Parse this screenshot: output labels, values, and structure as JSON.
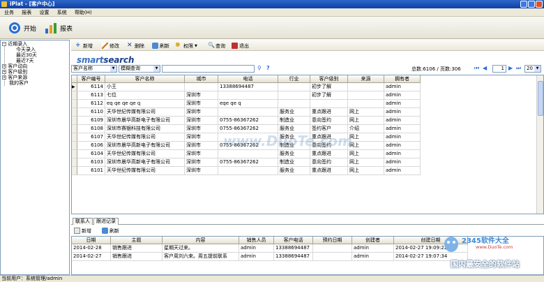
{
  "window": {
    "title": "iPlat - [客户中心]"
  },
  "menu": [
    "业务",
    "报表",
    "设置",
    "系统",
    "帮助(H)"
  ],
  "bigbar": {
    "start": "开始",
    "report": "报表"
  },
  "tree": {
    "root": "近期录入",
    "children": [
      "今天录入",
      "最近30天",
      "最近7天"
    ],
    "others": [
      "客户动向",
      "客户级别",
      "客户来源",
      "我的客户"
    ]
  },
  "actions": [
    "新增",
    "修改",
    "删除",
    "刷新",
    "权限",
    "查询",
    "退出"
  ],
  "brand": {
    "part1": "smart",
    "part2": "search"
  },
  "search": {
    "field": "客户名称",
    "mode": "模糊查询",
    "value": ""
  },
  "pager": {
    "summary": "总数:6106 / 页数:306",
    "page": "1",
    "size": "20"
  },
  "grid": {
    "columns": [
      "客户编号",
      "客户名称",
      "城市",
      "电话",
      "行业",
      "客户级别",
      "来源",
      "拥有者"
    ],
    "rows": [
      [
        "6114",
        "小王",
        "",
        "13388694487",
        "",
        "初步了解",
        "",
        "admin"
      ],
      [
        "6113",
        "七位",
        "深圳市",
        "",
        "",
        "初步了解",
        "",
        "admin"
      ],
      [
        "6112",
        "eq qe qe qe q",
        "深圳市",
        "eqe qe q",
        "",
        "",
        "",
        "admin"
      ],
      [
        "6110",
        "天华世纪传媒有限公司",
        "深圳市",
        "",
        "服务业",
        "重点跟进",
        "网上",
        "admin"
      ],
      [
        "6109",
        "深圳市晨华高新电子有限公司",
        "深圳市",
        "0755-86367262",
        "制造业",
        "意向签约",
        "网上",
        "admin"
      ],
      [
        "6108",
        "深圳市赛银科技有限公司",
        "深圳市",
        "0755-86367262",
        "服务业",
        "签约客户",
        "介绍",
        "admin"
      ],
      [
        "6107",
        "天华世纪传媒有限公司",
        "深圳市",
        "",
        "服务业",
        "重点跟进",
        "网上",
        "admin"
      ],
      [
        "6106",
        "深圳市晨华高新电子有限公司",
        "深圳市",
        "0755-86367262",
        "制造业",
        "意向签约",
        "网上",
        "admin"
      ],
      [
        "6104",
        "天华世纪传媒有限公司",
        "深圳市",
        "",
        "服务业",
        "重点跟进",
        "网上",
        "admin"
      ],
      [
        "6103",
        "深圳市晨华高新电子有限公司",
        "深圳市",
        "0755-86367262",
        "制造业",
        "意向签约",
        "网上",
        "admin"
      ],
      [
        "6101",
        "天华世纪传媒有限公司",
        "深圳市",
        "",
        "服务业",
        "重点跟进",
        "网上",
        "admin"
      ]
    ]
  },
  "tabs": [
    "联系人",
    "跟进记录"
  ],
  "lowactions": [
    "新增",
    "刷新"
  ],
  "grid2": {
    "columns": [
      "日期",
      "主题",
      "内容",
      "销售人员",
      "客户电话",
      "预约日期",
      "创建者",
      "创建日期"
    ],
    "rows": [
      [
        "2014-02-28",
        "销售跟进",
        "星期天过来。",
        "admin",
        "13388694487",
        "",
        "admin",
        "2014-02-27 19:09:22"
      ],
      [
        "2014-02-27",
        "销售跟进",
        "客户周刘六来。周五提前联系",
        "admin",
        "13388694487",
        "",
        "admin",
        "2014-02-27 19:07:34"
      ]
    ]
  },
  "status": {
    "user": "当前用户：系统管理/admin"
  },
  "watermark": {
    "mid": "www.DuoTe.com",
    "brand": "2345软件大全",
    "url": "www.DuoTe.com",
    "slogan": "国内最安全的软件站"
  },
  "colors": {
    "titlebar": "#0f3fa8",
    "accent": "#1a3f8a",
    "panel": "#ece9d8"
  }
}
